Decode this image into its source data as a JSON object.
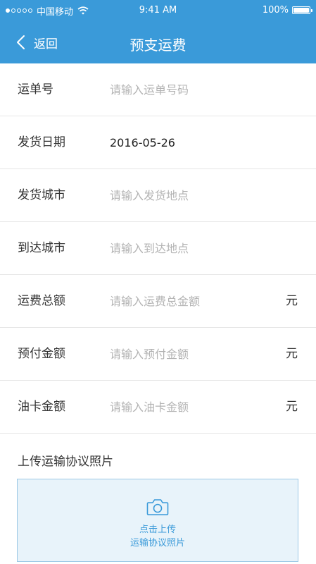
{
  "colors": {
    "header_bg": "#3a9ad9",
    "accent": "#3a9ad9",
    "upload_bg": "#e8f3fa",
    "placeholder": "#b3b3b3"
  },
  "status_bar": {
    "carrier": "中国移动",
    "time": "9:41 AM",
    "battery": "100%",
    "battery_level": 1.0,
    "signal_icon": "signal-dots-icon",
    "wifi_icon": "wifi-icon",
    "battery_icon": "battery-icon"
  },
  "nav": {
    "back_label": "返回",
    "back_icon": "chevron-left-icon",
    "title": "预支运费"
  },
  "form": {
    "rows": [
      {
        "label": "运单号",
        "value": "",
        "placeholder": "请输入运单号码",
        "unit": ""
      },
      {
        "label": "发货日期",
        "value": "2016-05-26",
        "placeholder": "",
        "unit": ""
      },
      {
        "label": "发货城市",
        "value": "",
        "placeholder": "请输入发货地点",
        "unit": ""
      },
      {
        "label": "到达城市",
        "value": "",
        "placeholder": "请输入到达地点",
        "unit": ""
      },
      {
        "label": "运费总额",
        "value": "",
        "placeholder": "请输入运费总金额",
        "unit": "元"
      },
      {
        "label": "预付金额",
        "value": "",
        "placeholder": "请输入预付金额",
        "unit": "元"
      },
      {
        "label": "油卡金额",
        "value": "",
        "placeholder": "请输入油卡金额",
        "unit": "元"
      }
    ]
  },
  "upload": {
    "title": "上传运输协议照片",
    "icon": "camera-icon",
    "line1": "点击上传",
    "line2": "运输协议照片"
  }
}
